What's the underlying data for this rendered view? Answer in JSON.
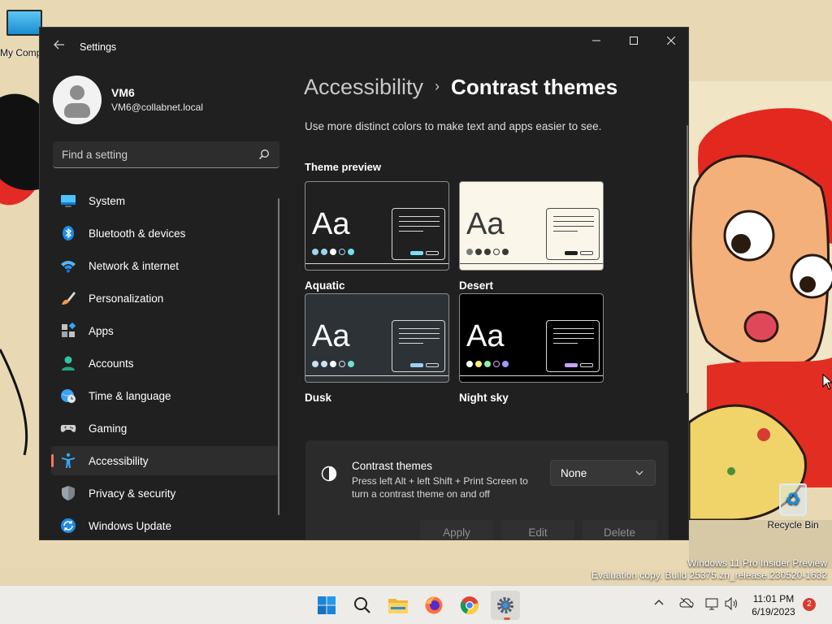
{
  "desktop": {
    "icons": {
      "my_computer": "My Computer",
      "recycle_bin": "Recycle Bin"
    },
    "watermark": {
      "line1": "Windows 11 Pro Insider Preview",
      "line2": "Evaluation copy. Build 25375.zn_release.230520-1632"
    }
  },
  "window": {
    "title": "Settings",
    "controls": {
      "minimize": "minimize-icon",
      "maximize": "maximize-icon",
      "close": "close-icon"
    }
  },
  "profile": {
    "name": "VM6",
    "email": "VM6@collabnet.local"
  },
  "search": {
    "placeholder": "Find a setting"
  },
  "nav": {
    "items": [
      {
        "label": "System",
        "icon": "system-icon"
      },
      {
        "label": "Bluetooth & devices",
        "icon": "bluetooth-icon"
      },
      {
        "label": "Network & internet",
        "icon": "network-icon"
      },
      {
        "label": "Personalization",
        "icon": "brush-icon"
      },
      {
        "label": "Apps",
        "icon": "apps-icon"
      },
      {
        "label": "Accounts",
        "icon": "accounts-icon"
      },
      {
        "label": "Time & language",
        "icon": "globe-clock-icon"
      },
      {
        "label": "Gaming",
        "icon": "gamepad-icon"
      },
      {
        "label": "Accessibility",
        "icon": "accessibility-icon",
        "active": true
      },
      {
        "label": "Privacy & security",
        "icon": "shield-icon"
      },
      {
        "label": "Windows Update",
        "icon": "update-icon"
      }
    ]
  },
  "content": {
    "breadcrumb": {
      "parent": "Accessibility",
      "separator": "›",
      "current": "Contrast themes"
    },
    "description": "Use more distinct colors to make text and apps easier to see.",
    "theme_preview_label": "Theme preview",
    "themes": [
      {
        "name": "Aquatic",
        "preview_text": "Aa",
        "bg": "#202020",
        "fg": "#ffffff",
        "dots": [
          "#9fd3f0",
          "#9fd3f0",
          "#ffffff",
          "#9fd3f0",
          "#6fe0f0"
        ],
        "accent": "#75e0f8"
      },
      {
        "name": "Desert",
        "preview_text": "Aa",
        "bg": "#fbf6ea",
        "fg": "#3a3a3a",
        "dots": [
          "#7a7a7a",
          "#3a3a3a",
          "#3a3a3a",
          "#3a3a3a",
          "#3a3a3a"
        ],
        "accent": "#202020"
      },
      {
        "name": "Dusk",
        "preview_text": "Aa",
        "bg": "#2d3236",
        "fg": "#ffffff",
        "dots": [
          "#c9e1f2",
          "#c9e1f2",
          "#ffffff",
          "#c9e1f2",
          "#6fe0d6"
        ],
        "accent": "#9ad0f5"
      },
      {
        "name": "Night sky",
        "preview_text": "Aa",
        "bg": "#000000",
        "fg": "#ffffff",
        "dots": [
          "#ffffff",
          "#ffef6e",
          "#8ff0a4",
          "#d7a3ff",
          "#9a9aff"
        ],
        "accent": "#c8a0ff"
      }
    ],
    "contrast_card": {
      "title": "Contrast themes",
      "subtitle": "Press left Alt + left Shift + Print Screen to turn a contrast theme on and off",
      "dropdown_value": "None",
      "buttons": {
        "apply": "Apply",
        "edit": "Edit",
        "delete": "Delete"
      }
    }
  },
  "taskbar": {
    "apps": [
      "windows-start-icon",
      "search-icon",
      "file-explorer-icon",
      "firefox-icon",
      "chrome-icon",
      "settings-icon"
    ],
    "clock": {
      "time": "11:01 PM",
      "date": "6/19/2023"
    },
    "notification_count": "2"
  },
  "colors": {
    "accent": "#f27a61",
    "window_bg": "#202020"
  }
}
